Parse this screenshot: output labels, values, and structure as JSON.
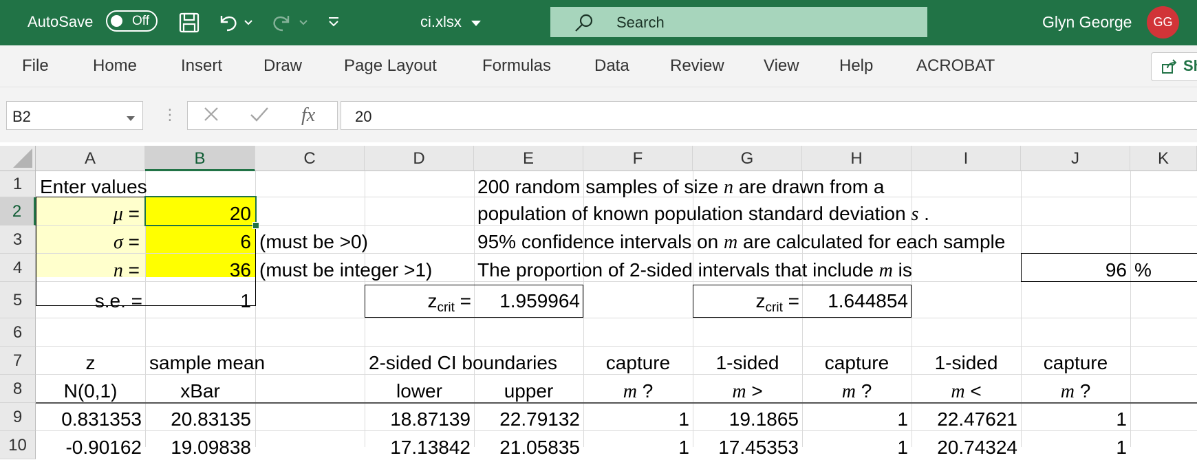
{
  "titlebar": {
    "autosave_label": "AutoSave",
    "autosave_state": "Off",
    "file_name": "ci.xlsx",
    "search_placeholder": "Search",
    "user_name": "Glyn George",
    "user_initials": "GG",
    "icons": [
      "save-icon",
      "undo-icon",
      "redo-icon",
      "customize-qat-icon",
      "search-icon"
    ],
    "colors": {
      "bar": "#217346",
      "search": "#a7d5bc",
      "avatar": "#d13438"
    }
  },
  "ribbon": {
    "tabs": [
      "File",
      "Home",
      "Insert",
      "Draw",
      "Page Layout",
      "Formulas",
      "Data",
      "Review",
      "View",
      "Help",
      "ACROBAT"
    ],
    "share_label": "Sh"
  },
  "formula_bar": {
    "name_box": "B2",
    "fx_label": "fx",
    "content": "20"
  },
  "sheet": {
    "columns": [
      "A",
      "B",
      "C",
      "D",
      "E",
      "F",
      "G",
      "H",
      "I",
      "J",
      "K"
    ],
    "rows": [
      "1",
      "2",
      "3",
      "4",
      "5",
      "6",
      "7",
      "8",
      "9",
      "10"
    ],
    "selected_cell": "B2",
    "cells": {
      "A1": "Enter values",
      "A2_sym": "μ",
      "A2_eq": " =",
      "A3_sym": "σ",
      "A3_eq": " =",
      "A4_sym": "n",
      "A4_eq": " =",
      "A5": "s.e. =",
      "B2": "20",
      "B3": "6",
      "B4": "36",
      "B5": "1",
      "C3": "(must be >0)",
      "C4": "(must be integer >1)",
      "E1_a": "200 random samples of size ",
      "E1_n": "n",
      "E1_b": " are drawn from a",
      "E2_a": "population of known population standard deviation ",
      "E2_s": "s",
      "E2_b": " .",
      "E3_a": "95% confidence intervals on ",
      "E3_m": "m",
      "E3_b": " are calculated for each sample",
      "E4_a": "The proportion of 2-sided intervals that include ",
      "E4_m": "m",
      "E4_b": " is",
      "J4": "96",
      "K4": "%",
      "D5_z": "z",
      "D5_sub": "crit",
      "D5_eq": " =",
      "E5": "1.959964",
      "G5_z": "z",
      "G5_sub": "crit",
      "G5_eq": " =",
      "H5": "1.644854",
      "A7": "z",
      "B7": "sample mean",
      "D7": "2-sided CI boundaries",
      "F7": "capture",
      "G7": "1-sided",
      "H7": "capture",
      "I7": "1-sided",
      "J7": "capture",
      "A8": "N(0,1)",
      "B8": "xBar",
      "D8": "lower",
      "E8": "upper",
      "F8_m": "m",
      "F8_b": " ?",
      "G8_m": "m",
      "G8_b": " >",
      "H8_m": "m",
      "H8_b": " ?",
      "I8_m": "m",
      "I8_b": " <",
      "J8_m": "m",
      "J8_b": " ?",
      "A9": "0.831353",
      "B9": "20.83135",
      "D9": "18.87139",
      "E9": "22.79132",
      "F9": "1",
      "G9": "19.1865",
      "H9": "1",
      "I9": "22.47621",
      "J9": "1",
      "A10": "-0.90162",
      "B10": "19.09838",
      "D10": "17.13842",
      "E10": "21.05835",
      "F10": "1",
      "G10": "17.45353",
      "H10": "1",
      "I10": "20.74324",
      "J10": "1"
    },
    "colors": {
      "input_fill": "#ffff00",
      "label_fill": "#ffffcc",
      "selection": "#217346"
    }
  }
}
